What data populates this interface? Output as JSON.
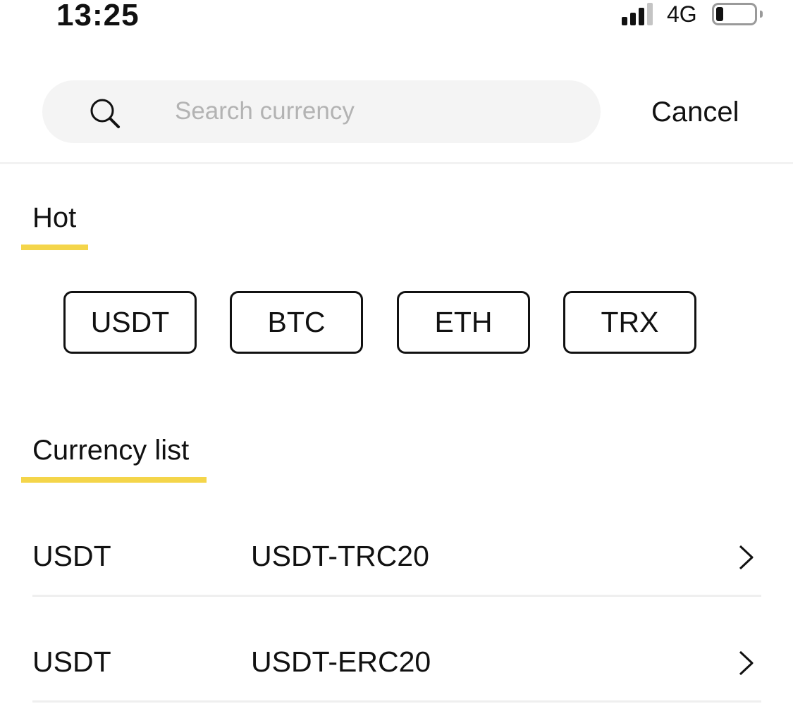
{
  "status_bar": {
    "time": "13:25",
    "network": "4G",
    "icons": [
      "signal-icon",
      "battery-icon"
    ]
  },
  "search": {
    "placeholder": "Search currency",
    "value": "",
    "icon": "search-icon",
    "cancel_label": "Cancel"
  },
  "hot": {
    "title": "Hot",
    "items": [
      "USDT",
      "BTC",
      "ETH",
      "TRX"
    ]
  },
  "currency_list": {
    "title": "Currency list",
    "items": [
      {
        "symbol": "USDT",
        "network": "USDT-TRC20",
        "icon": "chevron-right-icon"
      },
      {
        "symbol": "USDT",
        "network": "USDT-ERC20",
        "icon": "chevron-right-icon"
      }
    ]
  },
  "colors": {
    "accent_underline": "#f4d54a",
    "search_bg": "#f4f4f4",
    "placeholder": "#b3b3b3",
    "text": "#111111"
  }
}
